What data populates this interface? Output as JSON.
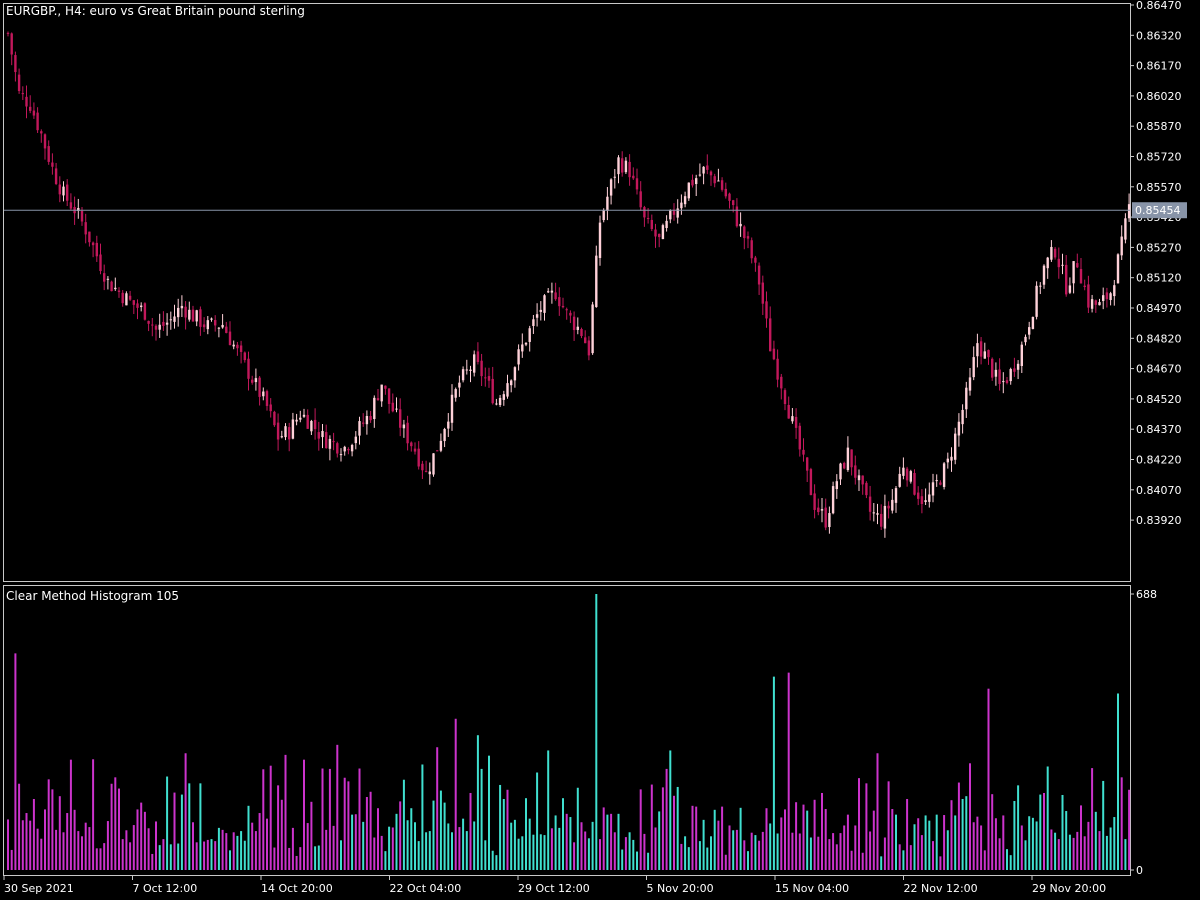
{
  "main_title": "EURGBP., H4:  euro vs Great Britain pound sterling",
  "sub_title": "Clear Method Histogram 105",
  "colors": {
    "background": "#000000",
    "frame": "#c8c8c8",
    "bear_candle": "#c2185b",
    "bull_candle": "#ffd1d9",
    "hist_up": "#40e0d0",
    "hist_down": "#cc33cc",
    "price_line": "#8894a8",
    "price_box": "#8894a8"
  },
  "current_price": "0.85454",
  "chart_data": [
    {
      "type": "candlestick",
      "title": "EURGBP., H4:  euro vs Great Britain pound sterling",
      "y_ticks": [
        "0.86470",
        "0.86320",
        "0.86170",
        "0.86020",
        "0.85870",
        "0.85720",
        "0.85570",
        "0.85420",
        "0.85270",
        "0.85120",
        "0.84970",
        "0.84820",
        "0.84670",
        "0.84520",
        "0.84370",
        "0.84220",
        "0.84070",
        "0.83920"
      ],
      "ylim": [
        0.8379,
        0.8648
      ],
      "current_price": 0.85454,
      "close_path": [
        [
          0,
          0.8633
        ],
        [
          3,
          0.8603
        ],
        [
          6,
          0.8598
        ],
        [
          9,
          0.8583
        ],
        [
          12,
          0.8566
        ],
        [
          15,
          0.8553
        ],
        [
          18,
          0.8546
        ],
        [
          21,
          0.8536
        ],
        [
          24,
          0.8523
        ],
        [
          27,
          0.851
        ],
        [
          30,
          0.8505
        ],
        [
          33,
          0.85
        ],
        [
          37,
          0.8495
        ],
        [
          40,
          0.8486
        ],
        [
          44,
          0.8491
        ],
        [
          47,
          0.8498
        ],
        [
          50,
          0.8493
        ],
        [
          54,
          0.8488
        ],
        [
          58,
          0.8489
        ],
        [
          62,
          0.8475
        ],
        [
          66,
          0.8462
        ],
        [
          70,
          0.8448
        ],
        [
          73,
          0.8433
        ],
        [
          76,
          0.8436
        ],
        [
          79,
          0.8445
        ],
        [
          82,
          0.844
        ],
        [
          85,
          0.8433
        ],
        [
          88,
          0.843
        ],
        [
          91,
          0.8428
        ],
        [
          94,
          0.8435
        ],
        [
          98,
          0.8445
        ],
        [
          101,
          0.846
        ],
        [
          103,
          0.845
        ],
        [
          107,
          0.8436
        ],
        [
          110,
          0.8427
        ],
        [
          113,
          0.8415
        ],
        [
          116,
          0.8428
        ],
        [
          119,
          0.8445
        ],
        [
          122,
          0.846
        ],
        [
          126,
          0.847
        ],
        [
          129,
          0.8462
        ],
        [
          132,
          0.845
        ],
        [
          136,
          0.8465
        ],
        [
          140,
          0.8482
        ],
        [
          144,
          0.8497
        ],
        [
          148,
          0.8505
        ],
        [
          151,
          0.8494
        ],
        [
          155,
          0.8485
        ],
        [
          157,
          0.8476
        ],
        [
          160,
          0.854
        ],
        [
          163,
          0.8558
        ],
        [
          165,
          0.857
        ],
        [
          168,
          0.8565
        ],
        [
          172,
          0.854
        ],
        [
          176,
          0.853
        ],
        [
          180,
          0.8545
        ],
        [
          184,
          0.8558
        ],
        [
          188,
          0.8565
        ],
        [
          192,
          0.856
        ],
        [
          196,
          0.8545
        ],
        [
          200,
          0.8528
        ],
        [
          203,
          0.851
        ],
        [
          206,
          0.8478
        ],
        [
          209,
          0.846
        ],
        [
          212,
          0.844
        ],
        [
          215,
          0.842
        ],
        [
          218,
          0.84
        ],
        [
          221,
          0.8392
        ],
        [
          224,
          0.8412
        ],
        [
          227,
          0.8425
        ],
        [
          230,
          0.841
        ],
        [
          233,
          0.8396
        ],
        [
          236,
          0.8392
        ],
        [
          239,
          0.8402
        ],
        [
          242,
          0.842
        ],
        [
          245,
          0.8408
        ],
        [
          248,
          0.84
        ],
        [
          251,
          0.841
        ],
        [
          254,
          0.842
        ],
        [
          257,
          0.844
        ],
        [
          260,
          0.846
        ],
        [
          262,
          0.848
        ],
        [
          265,
          0.847
        ],
        [
          268,
          0.8458
        ],
        [
          271,
          0.8465
        ],
        [
          274,
          0.8478
        ],
        [
          277,
          0.8497
        ],
        [
          280,
          0.8517
        ],
        [
          283,
          0.8526
        ],
        [
          286,
          0.8508
        ],
        [
          289,
          0.852
        ],
        [
          292,
          0.85
        ],
        [
          295,
          0.8498
        ],
        [
          298,
          0.8505
        ],
        [
          301,
          0.8528
        ],
        [
          303,
          0.8547
        ]
      ]
    },
    {
      "type": "bar",
      "title": "Clear Method Histogram 105",
      "y_ticks": [
        "688",
        "0"
      ],
      "ylim": [
        0,
        688
      ],
      "x_tick_labels": [
        "30 Sep 2021",
        "7 Oct 12:00",
        "14 Oct 20:00",
        "22 Oct 04:00",
        "29 Oct 12:00",
        "5 Nov 20:00",
        "15 Nov 04:00",
        "22 Nov 12:00",
        "29 Nov 20:00"
      ],
      "series": [
        {
          "name": "",
          "values": [
            {
              "range": [
                0,
                40
              ],
              "color": "down"
            },
            {
              "range": [
                41,
                66
              ],
              "color": "mixed"
            },
            {
              "range": [
                67,
                104
              ],
              "color": "mixed_down"
            },
            {
              "range": [
                105,
                150
              ],
              "color": "up"
            },
            {
              "range": [
                151,
                196
              ],
              "color": "mixed"
            },
            {
              "range": [
                197,
                235
              ],
              "color": "mixed_down"
            },
            {
              "range": [
                236,
                266
              ],
              "color": "mixed"
            },
            {
              "range": [
                267,
                303
              ],
              "color": "mixed"
            }
          ]
        }
      ],
      "notable_values": [
        {
          "bar": 2,
          "value": 540
        },
        {
          "bar": 159,
          "value": 688
        },
        {
          "bar": 207,
          "value": 482
        },
        {
          "bar": 211,
          "value": 492
        },
        {
          "bar": 265,
          "value": 452
        },
        {
          "bar": 300,
          "value": 440
        }
      ]
    }
  ]
}
